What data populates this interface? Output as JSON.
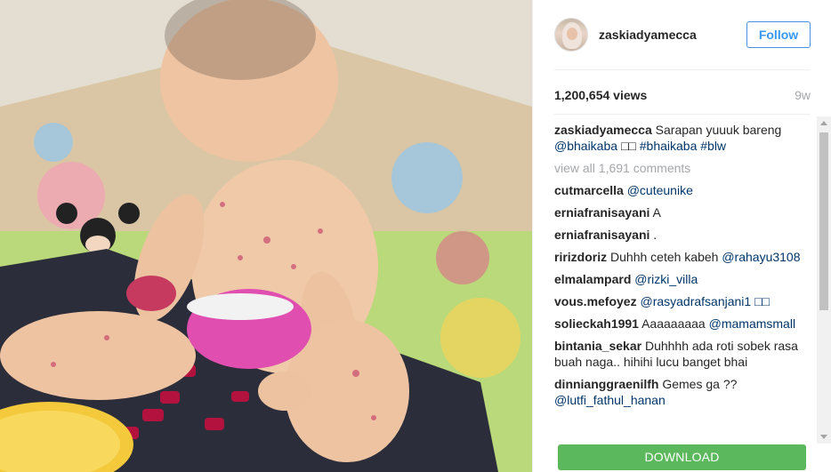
{
  "post": {
    "media_description": "photo"
  },
  "header": {
    "username": "zaskiadyamecca",
    "follow_label": "Follow"
  },
  "stats": {
    "views": "1,200,654 views",
    "age": "9w"
  },
  "caption": {
    "username": "zaskiadyamecca",
    "text": "Sarapan yuuuk bareng",
    "mention": "@bhaikaba",
    "emoji": "□□",
    "tags": "#bhaikaba #blw"
  },
  "view_all": "view all 1,691 comments",
  "comments": [
    {
      "user": "cutmarcella",
      "text": "",
      "mention": "@cuteunike"
    },
    {
      "user": "erniafranisayani",
      "text": "A",
      "mention": ""
    },
    {
      "user": "erniafranisayani",
      "text": ".",
      "mention": ""
    },
    {
      "user": "ririzdoriz",
      "text": "Duhhh ceteh kabeh",
      "mention": "@rahayu3108"
    },
    {
      "user": "elmalampard",
      "text": "",
      "mention": "@rizki_villa"
    },
    {
      "user": "vous.mefoyez",
      "text": "",
      "mention": "@rasyadrafsanjani1 □□"
    },
    {
      "user": "solieckah1991",
      "text": "Aaaaaaaaa",
      "mention": "@mamamsmall"
    },
    {
      "user": "bintania_sekar",
      "text": "Duhhhh ada roti sobek rasa buah naga.. hihihi lucu banget bhai",
      "mention": ""
    },
    {
      "user": "dinnianggraenilfh",
      "text": "Gemes ga ??",
      "mention": "@lutfi_fathul_hanan"
    }
  ],
  "download_label": "DOWNLOAD",
  "colors": {
    "follow_blue": "#3897f0",
    "mention_blue": "#003569",
    "download_green": "#5cb85c",
    "muted_gray": "#a5a7aa"
  }
}
